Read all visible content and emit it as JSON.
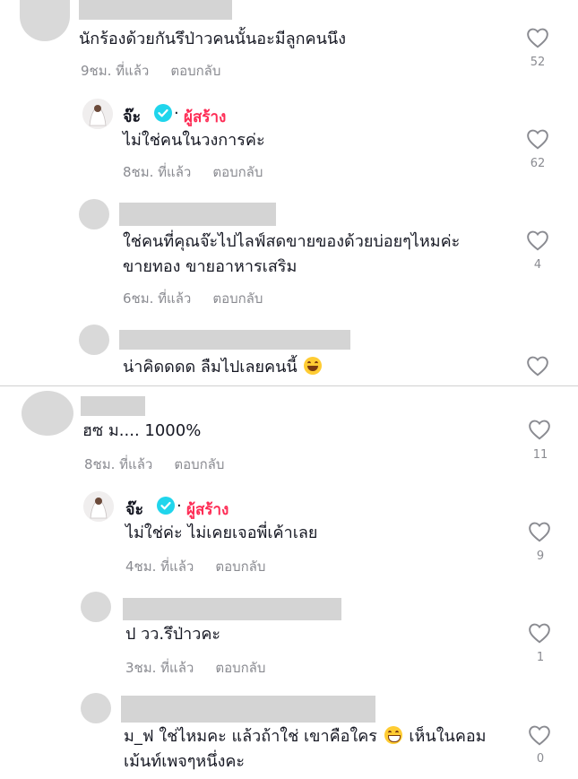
{
  "colors": {
    "accent": "#fe2c55",
    "verified": "#20d5ec",
    "meta": "#8a8b91"
  },
  "creator": {
    "name": "จ๊ะ",
    "dot": "·",
    "tag": "ผู้สร้าง"
  },
  "reply_label": "ตอบกลับ",
  "comments": [
    {
      "text": "นักร้องด้วยกันรึป่าวคนนั้นอะมีลูกคนนึง",
      "time": "9ชม. ที่แล้ว",
      "likes": "52"
    },
    {
      "text": "ไม่ใช่คนในวงการค่ะ",
      "time": "8ชม. ที่แล้ว",
      "likes": "62"
    },
    {
      "text_line1": "ใช่คนที่คุณจ๊ะไปไลฟ์สดขายของด้วยบ่อยๆไหมค่ะ",
      "text_line2": "ขายทอง ขายอาหารเสริม",
      "time": "6ชม. ที่แล้ว",
      "likes": "4"
    },
    {
      "text": "น่าคิดดดด ลืมไปเลยคนนี้",
      "emoji": "laughing-emoji"
    },
    {
      "text": "ฮซ ม.... 1000%",
      "time": "8ชม. ที่แล้ว",
      "likes": "11"
    },
    {
      "text": "ไม่ใช่ค่ะ ไม่เคยเจอพี่เค้าเลย",
      "time": "4ชม. ที่แล้ว",
      "likes": "9"
    },
    {
      "text": "ป วว.รึป่าวคะ",
      "time": "3ชม. ที่แล้ว",
      "likes": "1"
    },
    {
      "text_line1_a": "ม_ฟ ใช่ไหมคะ แล้วถ้าใช่ เขาคือใคร",
      "emoji": "grinning-emoji",
      "text_line1_b": "เห็นในคอม",
      "text_line2": "เม้นท์เพจๆหนึ่งคะ",
      "likes": "0"
    }
  ]
}
